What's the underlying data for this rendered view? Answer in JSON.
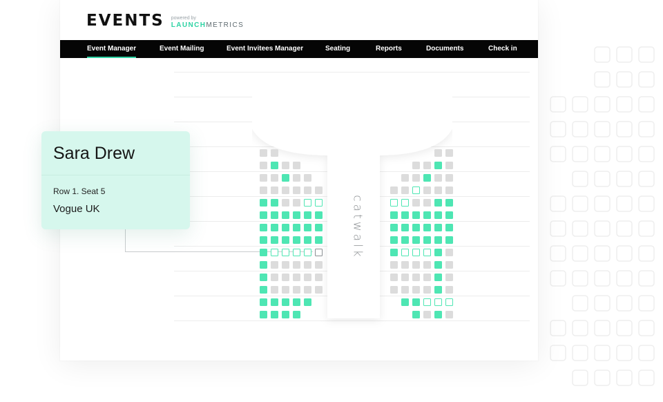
{
  "brand": {
    "logo_text": "EVENTS",
    "powered_by": "powered by",
    "launch": "LAUNCH",
    "metrics": "METRICS",
    "accent_color": "#2fd3a4"
  },
  "nav": {
    "items": [
      {
        "label": "Event Manager",
        "active": true
      },
      {
        "label": "Event Mailing",
        "active": false
      },
      {
        "label": "Event Invitees Manager",
        "active": false
      },
      {
        "label": "Seating",
        "active": false
      },
      {
        "label": "Reports",
        "active": false
      },
      {
        "label": "Documents",
        "active": false
      },
      {
        "label": "Check in",
        "active": false
      }
    ]
  },
  "stage": {
    "catwalk_label": "catwalk"
  },
  "seating": {
    "left_section": [
      "gg",
      "gtgg",
      "ggtgg",
      "gggggg",
      "ttggoo",
      "tttttt",
      "tttttt",
      "tttttt",
      "tooooS",
      "tggggg",
      "tggggg",
      "tggggg",
      "ttttt",
      "tttt"
    ],
    "right_section": [
      "gg",
      "ggtg",
      "ggtgg",
      "ggoggg",
      "ooggtt",
      "tttttt",
      "tttttt",
      "tttttt",
      "toootg",
      "ggggtg",
      "ggggtg",
      "ggggtg",
      "ttooo",
      "tgtg"
    ],
    "legend": {
      "occupied_color": "#4ee6b3",
      "unavailable_color": "#dcdcdc"
    }
  },
  "guest_card": {
    "name": "Sara Drew",
    "seat": "Row 1. Seat 5",
    "publication": "Vogue UK"
  }
}
